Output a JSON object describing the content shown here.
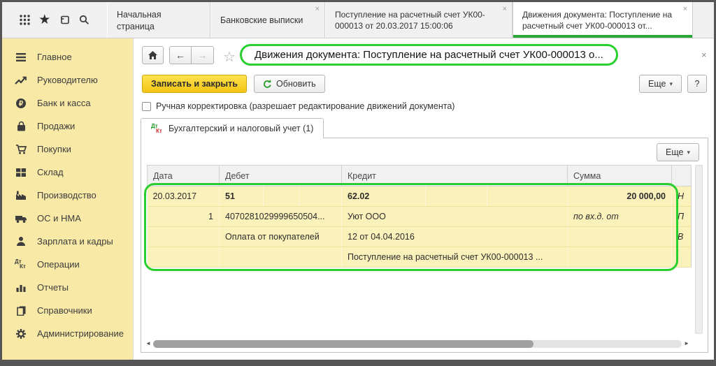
{
  "topbar": {
    "tabs": [
      {
        "label": "Начальная страница",
        "closable": false,
        "active": false
      },
      {
        "label": "Банковские выписки",
        "closable": true,
        "active": false
      },
      {
        "label": "Поступление на расчетный счет УК00-000013 от 20.03.2017 15:00:06",
        "closable": true,
        "active": false
      },
      {
        "label": "Движения документа: Поступление на расчетный счет УК00-000013 от...",
        "closable": true,
        "active": true
      }
    ],
    "icons": [
      "apps-grid",
      "favorites-star",
      "history",
      "search"
    ]
  },
  "glyphs": {
    "close": "×",
    "star_filled": "★",
    "star_outline": "☆",
    "back": "←",
    "forward": "→",
    "caret_down": "▾",
    "scroll_left": "◄",
    "scroll_right": "►"
  },
  "sidebar": {
    "items": [
      {
        "label": "Главное",
        "icon": "menu-icon"
      },
      {
        "label": "Руководителю",
        "icon": "trend-icon"
      },
      {
        "label": "Банк и касса",
        "icon": "ruble-icon"
      },
      {
        "label": "Продажи",
        "icon": "bag-icon"
      },
      {
        "label": "Покупки",
        "icon": "cart-icon"
      },
      {
        "label": "Склад",
        "icon": "boxes-icon"
      },
      {
        "label": "Производство",
        "icon": "factory-icon"
      },
      {
        "label": "ОС и НМА",
        "icon": "truck-icon"
      },
      {
        "label": "Зарплата и кадры",
        "icon": "person-icon"
      },
      {
        "label": "Операции",
        "icon": "dtkt-icon"
      },
      {
        "label": "Отчеты",
        "icon": "barchart-icon"
      },
      {
        "label": "Справочники",
        "icon": "books-icon"
      },
      {
        "label": "Администрирование",
        "icon": "gear-icon"
      }
    ],
    "dtkt": {
      "dt": "Дт",
      "kt": "Кт"
    }
  },
  "nav": {
    "title": "Движения документа: Поступление на расчетный счет УК00-000013 о..."
  },
  "toolbar": {
    "save_close_label": "Записать и закрыть",
    "refresh_label": "Обновить",
    "more_label": "Еще",
    "help_label": "?"
  },
  "manual_adjust": {
    "label": "Ручная корректировка (разрешает редактирование движений документа)",
    "checked": false
  },
  "doc_tab": {
    "label": "Бухгалтерский и налоговый учет (1)",
    "icon_dt": "Дт",
    "icon_kt": "Кт"
  },
  "table": {
    "headers": {
      "date": "Дата",
      "debit": "Дебет",
      "credit": "Кредит",
      "sum": "Сумма"
    },
    "rows": [
      {
        "date": "20.03.2017",
        "debit": "51",
        "credit": "62.02",
        "sum": "20 000,00",
        "flag": "Н"
      },
      {
        "num": "1",
        "debit": "4070281029999650504...",
        "credit": "Уют ООО",
        "sum": "по вх.д.  от",
        "flag": "П"
      },
      {
        "debit": "Оплата от покупателей",
        "credit": "12 от 04.04.2016",
        "flag": "В"
      },
      {
        "credit": "Поступление на расчетный счет УК00-000013 ..."
      }
    ]
  },
  "colors": {
    "highlight_green": "#29cf2f",
    "active_tab_underline": "#2aa737",
    "save_button_yellow": "#f2c513",
    "row_yellow": "#fbf1ba",
    "current_cell_gold": "#eec117",
    "sidebar_yellow": "#f8e9a6"
  }
}
